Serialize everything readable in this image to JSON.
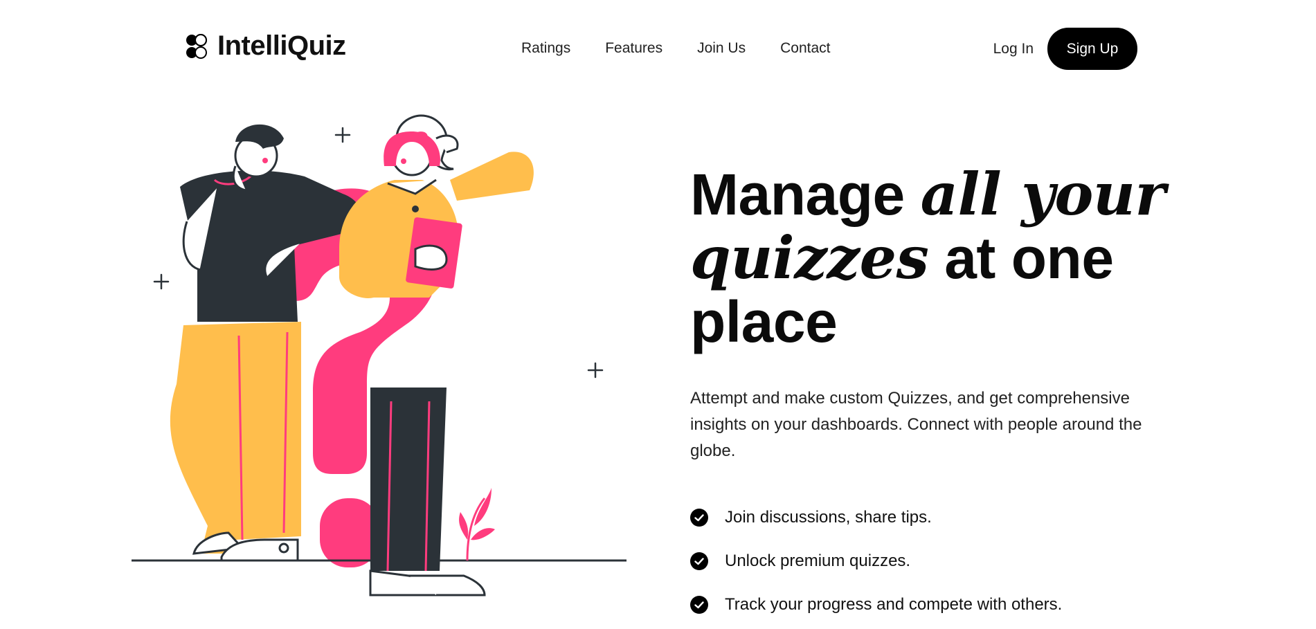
{
  "brand": {
    "name": "IntelliQuiz",
    "logo_icon": "intelliquiz-logo-icon"
  },
  "nav": {
    "links": [
      "Ratings",
      "Features",
      "Join Us",
      "Contact"
    ],
    "login_label": "Log In",
    "signup_label": "Sign Up"
  },
  "hero": {
    "headline_part1": "Manage ",
    "headline_italic1": "all your",
    "headline_italic2": "quizzes",
    "headline_part2": " at one place",
    "subtitle": "Attempt and make custom Quizzes, and get comprehensive insights on your dashboards. Connect with people around the globe.",
    "features": [
      "Join discussions, share tips.",
      "Unlock premium quizzes.",
      "Track your progress and compete with others."
    ],
    "check_icon": "check-circle-icon"
  },
  "colors": {
    "accent_pink": "#FF3C7E",
    "accent_yellow": "#FFBE4C",
    "dark": "#2B3238",
    "button_bg": "#000000"
  }
}
